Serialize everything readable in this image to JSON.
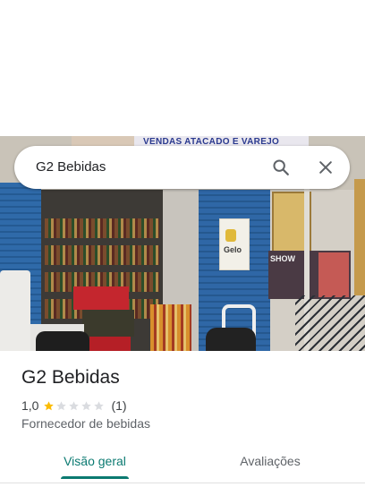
{
  "search": {
    "query": "G2 Bebidas",
    "search_icon": "search-icon",
    "close_icon": "close-icon"
  },
  "photo": {
    "banner_text": "VENDAS ATACADO E VAREJO",
    "poster_text": "Gelo",
    "show_text": "SHOW"
  },
  "place": {
    "name": "G2 Bebidas",
    "rating": "1,0",
    "stars_filled": 1,
    "stars_total": 5,
    "review_count": "(1)",
    "category": "Fornecedor de bebidas"
  },
  "tabs": [
    {
      "label": "Visão geral",
      "active": true
    },
    {
      "label": "Avaliações",
      "active": false
    }
  ],
  "colors": {
    "accent": "#0b7a71",
    "star_filled": "#fbbc04",
    "star_empty": "#dadce0"
  }
}
